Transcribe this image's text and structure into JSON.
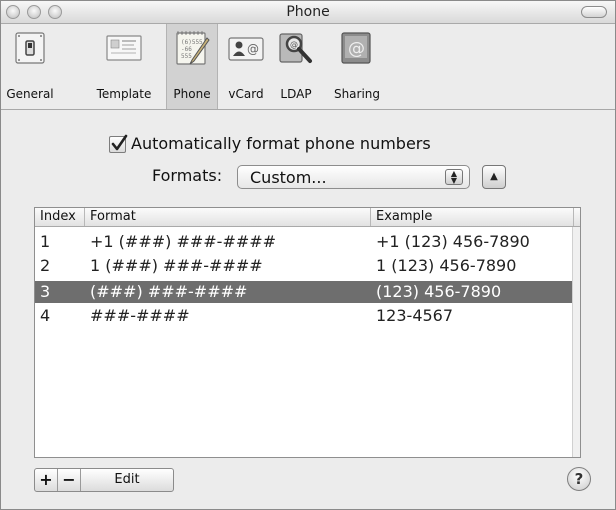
{
  "window": {
    "title": "Phone"
  },
  "toolbar": {
    "items": [
      {
        "label": "General",
        "icon": "general-switch-icon",
        "selected": false
      },
      {
        "label": "Template",
        "icon": "template-card-icon",
        "selected": false
      },
      {
        "label": "Phone",
        "icon": "phone-notepad-icon",
        "selected": true
      },
      {
        "label": "vCard",
        "icon": "vcard-icon",
        "selected": false
      },
      {
        "label": "LDAP",
        "icon": "ldap-search-icon",
        "selected": false
      },
      {
        "label": "Sharing",
        "icon": "sharing-at-icon",
        "selected": false
      }
    ]
  },
  "options": {
    "auto_format_label": "Automatically format phone numbers",
    "auto_format_checked": true,
    "formats_label": "Formats:",
    "formats_value": "Custom..."
  },
  "table": {
    "columns": [
      "Index",
      "Format",
      "Example"
    ],
    "rows": [
      {
        "index": "1",
        "format": "+1 (###) ###-####",
        "example": "+1 (123) 456-7890",
        "selected": false
      },
      {
        "index": "2",
        "format": "1 (###) ###-####",
        "example": "1 (123) 456-7890",
        "selected": false
      },
      {
        "index": "3",
        "format": "(###) ###-####",
        "example": "(123) 456-7890",
        "selected": true
      },
      {
        "index": "4",
        "format": "###-####",
        "example": "123-4567",
        "selected": false
      }
    ]
  },
  "buttons": {
    "add": "+",
    "remove": "−",
    "edit": "Edit",
    "help": "?"
  },
  "colors": {
    "selection": "#6e6e6e",
    "window_bg": "#ececec"
  }
}
